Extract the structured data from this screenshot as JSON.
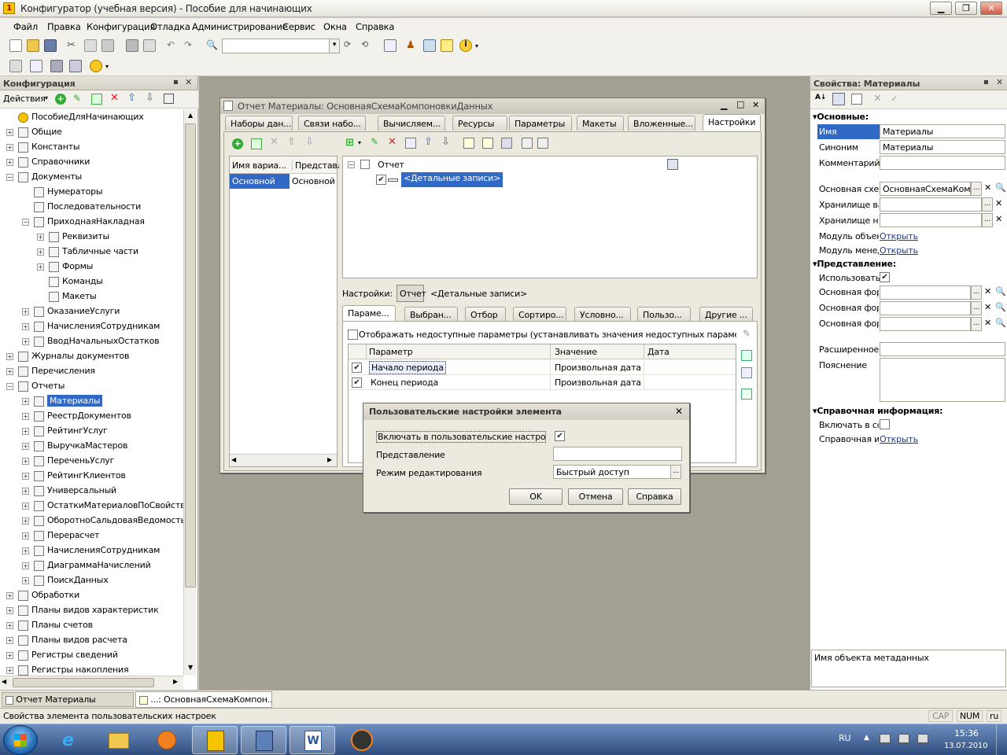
{
  "window": {
    "title": "Конфигуратор (учебная версия) - Пособие для начинающих"
  },
  "menu": [
    "Файл",
    "Правка",
    "Конфигурация",
    "Отладка",
    "Администрирование",
    "Сервис",
    "Окна",
    "Справка"
  ],
  "left_panel": {
    "title": "Конфигурация",
    "actions_label": "Действия",
    "tree": [
      {
        "label": "ПособиеДляНачинающих",
        "level": 0,
        "exp": ""
      },
      {
        "label": "Общие",
        "level": 0,
        "exp": "+"
      },
      {
        "label": "Константы",
        "level": 0,
        "exp": "+"
      },
      {
        "label": "Справочники",
        "level": 0,
        "exp": "+"
      },
      {
        "label": "Документы",
        "level": 0,
        "exp": "−"
      },
      {
        "label": "Нумераторы",
        "level": 1,
        "exp": ""
      },
      {
        "label": "Последовательности",
        "level": 1,
        "exp": ""
      },
      {
        "label": "ПриходнаяНакладная",
        "level": 1,
        "exp": "−"
      },
      {
        "label": "Реквизиты",
        "level": 2,
        "exp": "+"
      },
      {
        "label": "Табличные части",
        "level": 2,
        "exp": "+"
      },
      {
        "label": "Формы",
        "level": 2,
        "exp": "+"
      },
      {
        "label": "Команды",
        "level": 2,
        "exp": ""
      },
      {
        "label": "Макеты",
        "level": 2,
        "exp": ""
      },
      {
        "label": "ОказаниеУслуги",
        "level": 1,
        "exp": "+"
      },
      {
        "label": "НачисленияСотрудникам",
        "level": 1,
        "exp": "+"
      },
      {
        "label": "ВводНачальныхОстатков",
        "level": 1,
        "exp": "+"
      },
      {
        "label": "Журналы документов",
        "level": 0,
        "exp": "+"
      },
      {
        "label": "Перечисления",
        "level": 0,
        "exp": "+"
      },
      {
        "label": "Отчеты",
        "level": 0,
        "exp": "−"
      },
      {
        "label": "Материалы",
        "level": 1,
        "exp": "+",
        "selected": true
      },
      {
        "label": "РеестрДокументов",
        "level": 1,
        "exp": "+"
      },
      {
        "label": "РейтингУслуг",
        "level": 1,
        "exp": "+"
      },
      {
        "label": "ВыручкаМастеров",
        "level": 1,
        "exp": "+"
      },
      {
        "label": "ПереченьУслуг",
        "level": 1,
        "exp": "+"
      },
      {
        "label": "РейтингКлиентов",
        "level": 1,
        "exp": "+"
      },
      {
        "label": "Универсальный",
        "level": 1,
        "exp": "+"
      },
      {
        "label": "ОстаткиМатериаловПоСвойств...",
        "level": 1,
        "exp": "+"
      },
      {
        "label": "ОборотноСальдоваяВедомость",
        "level": 1,
        "exp": "+"
      },
      {
        "label": "Перерасчет",
        "level": 1,
        "exp": "+"
      },
      {
        "label": "НачисленияСотрудникам",
        "level": 1,
        "exp": "+"
      },
      {
        "label": "ДиаграммаНачислений",
        "level": 1,
        "exp": "+"
      },
      {
        "label": "ПоискДанных",
        "level": 1,
        "exp": "+"
      },
      {
        "label": "Обработки",
        "level": 0,
        "exp": "+"
      },
      {
        "label": "Планы видов характеристик",
        "level": 0,
        "exp": "+"
      },
      {
        "label": "Планы счетов",
        "level": 0,
        "exp": "+"
      },
      {
        "label": "Планы видов расчета",
        "level": 0,
        "exp": "+"
      },
      {
        "label": "Регистры сведений",
        "level": 0,
        "exp": "+"
      },
      {
        "label": "Регистры накопления",
        "level": 0,
        "exp": "+"
      }
    ]
  },
  "report_window": {
    "title": "Отчет Материалы: ОсновнаяСхемаКомпоновкиДанных",
    "tabs": [
      "Наборы дан...",
      "Связи набо...",
      "Вычисляем...",
      "Ресурсы",
      "Параметры",
      "Макеты",
      "Вложенные...",
      "Настройки"
    ],
    "variants": {
      "col1": "Имя вариа...",
      "col2": "Представл...",
      "row_name": "Основной",
      "row_repr": "Основной"
    },
    "structure": {
      "root": "Отчет",
      "child": "<Детальные записи>"
    },
    "settings_label": "Настройки:",
    "settings_btn": "Отчет",
    "settings_value": "<Детальные записи>",
    "subtabs": [
      "Параме...",
      "Выбран...",
      "Отбор",
      "Сортиро...",
      "Условно...",
      "Пользо...",
      "Другие ..."
    ],
    "show_unavailable": "Отображать недоступные параметры (устанавливать значения недоступных параметров не...",
    "params_headers": [
      "Параметр",
      "Значение",
      "Дата"
    ],
    "params_rows": [
      {
        "checked": true,
        "name": "Начало периода",
        "value": "Произвольная дата"
      },
      {
        "checked": true,
        "name": "Конец периода",
        "value": "Произвольная дата"
      }
    ]
  },
  "dialog": {
    "title": "Пользовательские настройки элемента",
    "include_label": "Включать в пользовательские настройки:",
    "repr_label": "Представление",
    "mode_label": "Режим редактирования",
    "mode_value": "Быстрый доступ",
    "ok": "OK",
    "cancel": "Отмена",
    "help": "Справка"
  },
  "properties": {
    "title": "Свойства: Материалы",
    "section_main": "Основные:",
    "name_label": "Имя",
    "name_value": "Материалы",
    "synonym_label": "Синоним",
    "synonym_value": "Материалы",
    "comment_label": "Комментарий",
    "schema_label": "Основная схем",
    "schema_value": "ОсновнаяСхемаКомп",
    "store_var_label": "Хранилище вар",
    "store_set_label": "Хранилище нас",
    "module_obj_label": "Модуль объект",
    "module_mgr_label": "Модуль менед:",
    "open": "Открыть",
    "section_repr": "Представление:",
    "use_label": "Использовать",
    "form_label": "Основная форм",
    "ext_label": "Расширенное г",
    "expl_label": "Пояснение",
    "section_ref": "Справочная информация:",
    "include_label": "Включать в сод",
    "refinfo_label": "Справочная ин",
    "footer": "Имя объекта метаданных"
  },
  "bottom_tabs": [
    "Отчет Материалы",
    "...: ОсновнаяСхемаКомпон..."
  ],
  "status": {
    "text": "Свойства элемента пользовательских настроек",
    "cap": "CAP",
    "num": "NUM",
    "lang": "ru"
  },
  "taskbar": {
    "lang": "RU",
    "time": "15:36",
    "date": "13.07.2010"
  }
}
